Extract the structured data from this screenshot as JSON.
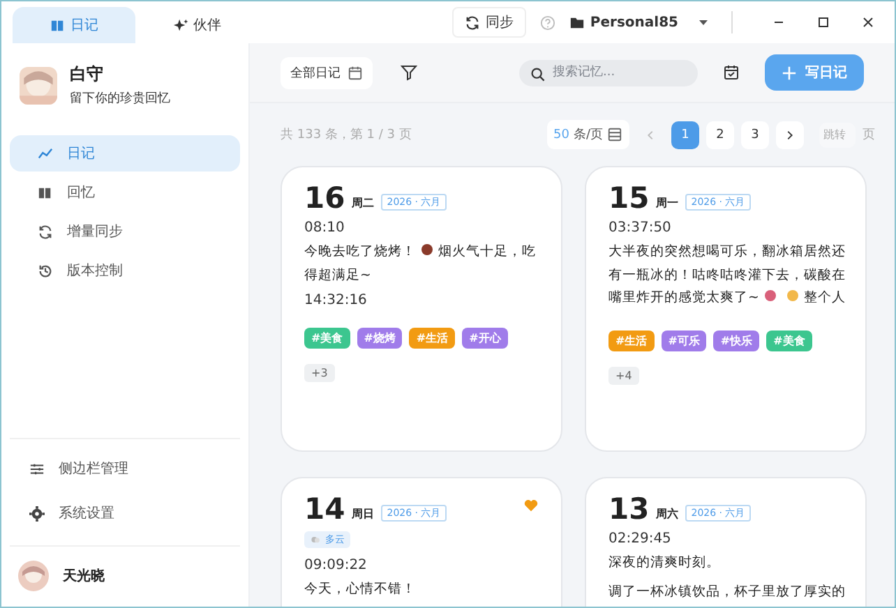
{
  "top_tabs": [
    {
      "label": "日记",
      "selected": true
    },
    {
      "label": "伙伴",
      "selected": false
    }
  ],
  "sync_button": "同步",
  "workspace": "Personal85",
  "profile": {
    "name": "白守",
    "subtitle": "留下你的珍贵回忆"
  },
  "nav": [
    {
      "label": "日记",
      "selected": true
    },
    {
      "label": "回忆",
      "selected": false
    },
    {
      "label": "增量同步",
      "selected": false
    },
    {
      "label": "版本控制",
      "selected": false
    }
  ],
  "sidebar_bottom": [
    "侧边栏管理",
    "系统设置"
  ],
  "user": "天光晓",
  "toolbar": {
    "filter": "全部日记",
    "search_placeholder": "搜索记忆...",
    "write_button": "写日记"
  },
  "summary": "共 133 条，第 1 / 3 页",
  "pagination": {
    "page_size": "50",
    "page_size_unit": "条/页",
    "pages": [
      {
        "label": "1",
        "selected": true
      },
      {
        "label": "2",
        "selected": false
      },
      {
        "label": "3",
        "selected": false
      }
    ],
    "jump_placeholder": "跳转",
    "jump_unit": "页"
  },
  "entries": [
    {
      "day": "16",
      "weekday": "周二",
      "month": "2026 · 六月",
      "favorite": false,
      "time": "08:10",
      "body": [
        {
          "kind": "text",
          "text": "今晚去吃了烧烤！"
        },
        {
          "kind": "icon",
          "color": "#8a3a2a"
        },
        {
          "kind": "text",
          "text": "烟火气十足，吃得超满足~"
        }
      ],
      "time2": "14:32:16",
      "tags": [
        {
          "label": "#美食",
          "color": "#3cc68f"
        },
        {
          "label": "#烧烤",
          "color": "#a07cea"
        },
        {
          "label": "#生活",
          "color": "#f29b12"
        },
        {
          "label": "#开心",
          "color": "#a07cea"
        }
      ],
      "more": "+3"
    },
    {
      "day": "15",
      "weekday": "周一",
      "month": "2026 · 六月",
      "favorite": false,
      "time": "03:37:50",
      "body": [
        {
          "kind": "text",
          "text": "大半夜的突然想喝可乐，翻冰箱居然还有一瓶冰的！咕咚咕咚灌下去，碳酸在嘴里炸开的感觉太爽了~"
        },
        {
          "kind": "icon",
          "color": "#d9607a"
        },
        {
          "kind": "icon",
          "color": "#f2b84a"
        },
        {
          "kind": "text",
          "text": "整个人"
        }
      ],
      "tags": [
        {
          "label": "#生活",
          "color": "#f29b12"
        },
        {
          "label": "#可乐",
          "color": "#a07cea"
        },
        {
          "label": "#快乐",
          "color": "#a07cea"
        },
        {
          "label": "#美食",
          "color": "#3cc68f"
        }
      ],
      "more": "+4"
    },
    {
      "day": "14",
      "weekday": "周日",
      "month": "2026 · 六月",
      "favorite": true,
      "weather": "多云",
      "time": "09:09:22",
      "body": [
        {
          "kind": "text",
          "text": "今天，心情不错！"
        }
      ]
    },
    {
      "day": "13",
      "weekday": "周六",
      "month": "2026 · 六月",
      "favorite": false,
      "time": "02:29:45",
      "body": [
        {
          "kind": "text",
          "text": "深夜的清爽时刻。"
        }
      ],
      "body2": "调了一杯冰镇饮品，杯子里放了厚实的"
    }
  ]
}
